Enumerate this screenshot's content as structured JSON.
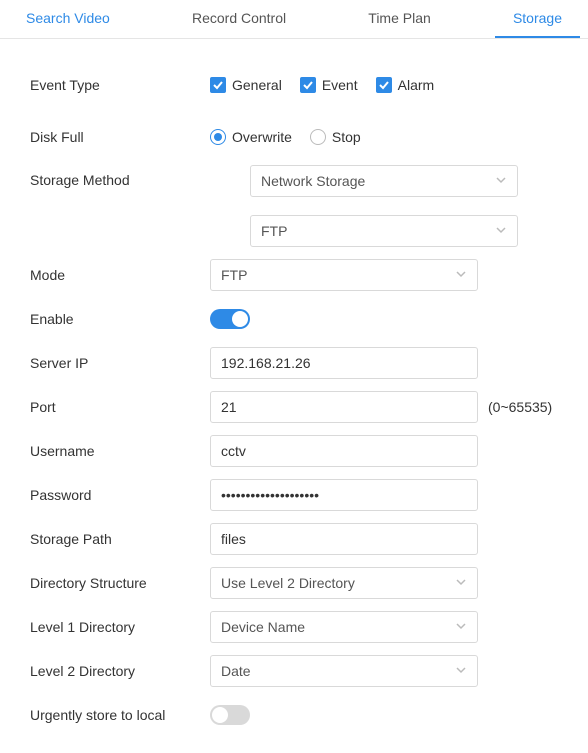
{
  "tabs": {
    "search_video": "Search Video",
    "record_control": "Record Control",
    "time_plan": "Time Plan",
    "storage": "Storage"
  },
  "labels": {
    "event_type": "Event Type",
    "disk_full": "Disk Full",
    "storage_method": "Storage Method",
    "mode": "Mode",
    "enable": "Enable",
    "server_ip": "Server IP",
    "port": "Port",
    "username": "Username",
    "password": "Password",
    "storage_path": "Storage Path",
    "directory_structure": "Directory Structure",
    "level1_directory": "Level 1 Directory",
    "level2_directory": "Level 2 Directory",
    "urgent_store": "Urgently store to local"
  },
  "event_type": {
    "general": "General",
    "event": "Event",
    "alarm": "Alarm"
  },
  "disk_full": {
    "overwrite": "Overwrite",
    "stop": "Stop"
  },
  "storage_method": {
    "primary": "Network Storage",
    "secondary": "FTP"
  },
  "mode": {
    "value": "FTP"
  },
  "server_ip": {
    "value": "192.168.21.26"
  },
  "port": {
    "value": "21",
    "hint": "(0~65535)"
  },
  "username": {
    "value": "cctv"
  },
  "password": {
    "value": "••••••••••••••••••••"
  },
  "storage_path": {
    "value": "files"
  },
  "directory_structure": {
    "value": "Use Level 2 Directory"
  },
  "level1_directory": {
    "value": "Device Name"
  },
  "level2_directory": {
    "value": "Date"
  }
}
